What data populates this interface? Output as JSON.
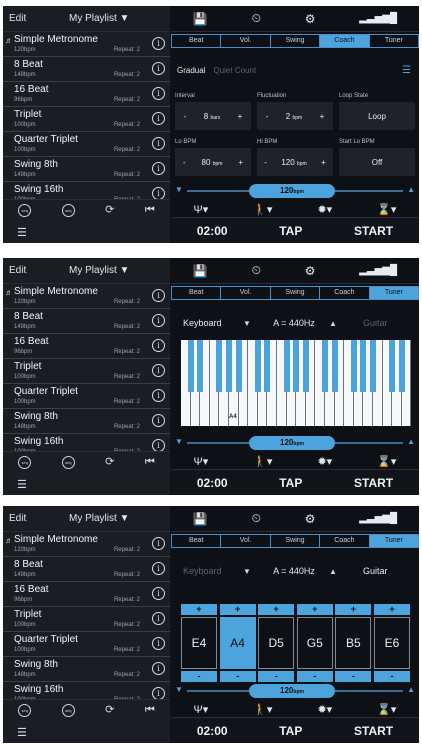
{
  "left": {
    "edit_label": "Edit",
    "playlist_label": "My Playlist ▼",
    "items": [
      {
        "name": "Simple Metronome",
        "bpm": "120bpm",
        "repeat": "Repeat: 2",
        "playing": true
      },
      {
        "name": "8 Beat",
        "bpm": "148bpm",
        "repeat": "Repeat: 2",
        "playing": false
      },
      {
        "name": "16 Beat",
        "bpm": "96bpm",
        "repeat": "Repeat: 2",
        "playing": false
      },
      {
        "name": "Triplet",
        "bpm": "100bpm",
        "repeat": "Repeat: 2",
        "playing": false
      },
      {
        "name": "Quarter Triplet",
        "bpm": "100bpm",
        "repeat": "Repeat: 2",
        "playing": false
      },
      {
        "name": "Swing 8th",
        "bpm": "148bpm",
        "repeat": "Repeat: 2",
        "playing": false
      },
      {
        "name": "Swing 16th",
        "bpm": "100bpm",
        "repeat": "Repeat: 2",
        "playing": false
      }
    ],
    "footer_icons": [
      "seq",
      "seq",
      "repeat",
      "skip-back"
    ],
    "footer_icon_glyphs": [
      "seq",
      "seq",
      "⟳",
      "⏮"
    ],
    "list_icon": "☰"
  },
  "top_icons": [
    "💾",
    "⏲",
    "⚙",
    "▂▃▅▆█"
  ],
  "tabs": [
    "Beat",
    "Vol.",
    "Swing",
    "Coach",
    "Tuner"
  ],
  "panels": [
    {
      "active_tab": 3,
      "mode": "coach"
    },
    {
      "active_tab": 4,
      "mode": "keyboard"
    },
    {
      "active_tab": 4,
      "mode": "guitar"
    }
  ],
  "coach": {
    "tab_gradual": "Gradual",
    "tab_quiet": "Quiet Count",
    "list_icon": "☰",
    "boxes": [
      {
        "label": "Interval",
        "value": "8",
        "unit": "bars"
      },
      {
        "label": "Fluctuation",
        "value": "2",
        "unit": "bpm"
      },
      {
        "label": "Loop State",
        "value": "Loop",
        "unit": ""
      },
      {
        "label": "Lo BPM",
        "value": "80",
        "unit": "bpm"
      },
      {
        "label": "Hi BPM",
        "value": "120",
        "unit": "bpm"
      },
      {
        "label": "Start Lo BPM",
        "value": "Off",
        "unit": ""
      }
    ]
  },
  "tuner": {
    "keyboard_label": "Keyboard",
    "pitch_label": "A = 440Hz",
    "guitar_label": "Guitar",
    "a4_label": "A4",
    "guitar_notes": [
      "E4",
      "A4",
      "D5",
      "G5",
      "B5",
      "E6"
    ],
    "active_note": 1
  },
  "tempo": {
    "value": "120",
    "unit": "bpm"
  },
  "controls": {
    "icons": [
      "Ψ▾",
      "🚶▾",
      "✹▾",
      "⌛▾"
    ],
    "timer": "02:00",
    "tap": "TAP",
    "start": "START"
  },
  "colors": {
    "accent": "#4da3dc",
    "bg": "#0d1014",
    "sidebar": "#1a1d22"
  }
}
